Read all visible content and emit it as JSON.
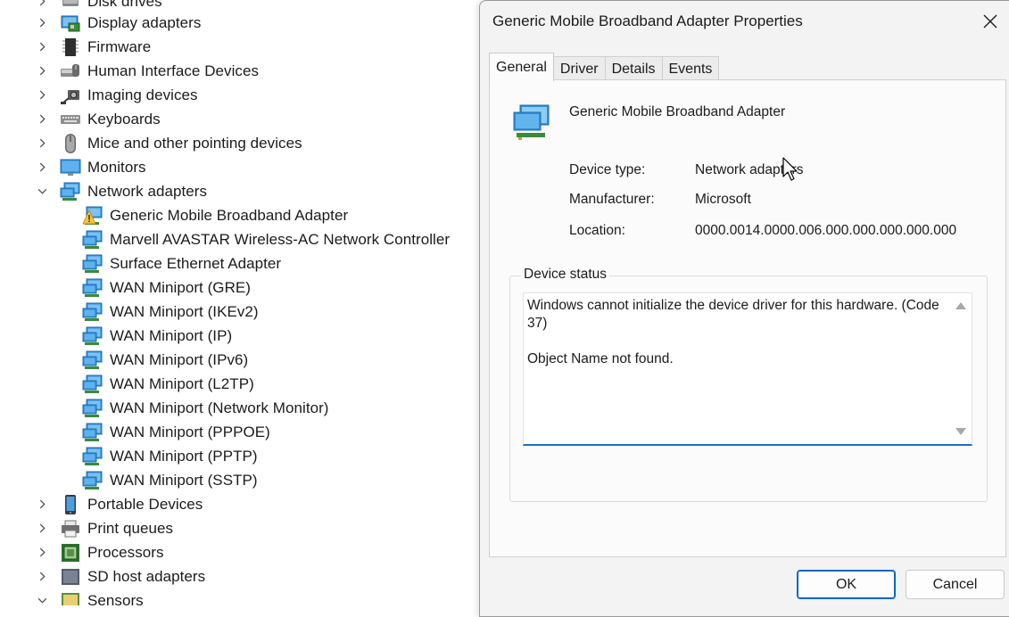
{
  "tree": {
    "categories_top": [
      {
        "label": "Disk drives",
        "icon": "disk-icon"
      },
      {
        "label": "Display adapters",
        "icon": "display-adapter-icon"
      },
      {
        "label": "Firmware",
        "icon": "firmware-chip-icon"
      },
      {
        "label": "Human Interface Devices",
        "icon": "hid-icon"
      },
      {
        "label": "Imaging devices",
        "icon": "camera-icon"
      },
      {
        "label": "Keyboards",
        "icon": "keyboard-icon"
      },
      {
        "label": "Mice and other pointing devices",
        "icon": "mouse-icon"
      },
      {
        "label": "Monitors",
        "icon": "monitor-icon"
      }
    ],
    "network_adapters": {
      "label": "Network adapters",
      "children": [
        "Generic Mobile Broadband Adapter",
        "Marvell AVASTAR Wireless-AC Network Controller",
        "Surface Ethernet Adapter",
        "WAN Miniport (GRE)",
        "WAN Miniport (IKEv2)",
        "WAN Miniport (IP)",
        "WAN Miniport (IPv6)",
        "WAN Miniport (L2TP)",
        "WAN Miniport (Network Monitor)",
        "WAN Miniport (PPPOE)",
        "WAN Miniport (PPTP)",
        "WAN Miniport (SSTP)"
      ]
    },
    "categories_bottom": [
      {
        "label": "Portable Devices",
        "icon": "portable-device-icon"
      },
      {
        "label": "Print queues",
        "icon": "printer-icon"
      },
      {
        "label": "Processors",
        "icon": "processor-icon"
      },
      {
        "label": "SD host adapters",
        "icon": "sd-card-icon"
      },
      {
        "label": "Sensors",
        "icon": "sensor-icon"
      }
    ]
  },
  "dialog": {
    "title": "Generic Mobile Broadband Adapter Properties",
    "tabs": [
      "General",
      "Driver",
      "Details",
      "Events"
    ],
    "active_tab": "General",
    "device_name": "Generic Mobile Broadband Adapter",
    "props": {
      "type_label": "Device type:",
      "type_value": "Network adapters",
      "manufacturer_label": "Manufacturer:",
      "manufacturer_value": "Microsoft",
      "location_label": "Location:",
      "location_value": "0000.0014.0000.006.000.000.000.000.000"
    },
    "status": {
      "legend": "Device status",
      "text": "Windows cannot initialize the device driver for this hardware. (Code 37)\n\nObject Name not found."
    },
    "ok_label": "OK",
    "cancel_label": "Cancel"
  },
  "colors": {
    "accent": "#0067c0",
    "monitor_blue": "#2f8fd8",
    "warning_yellow": "#f6c343"
  }
}
